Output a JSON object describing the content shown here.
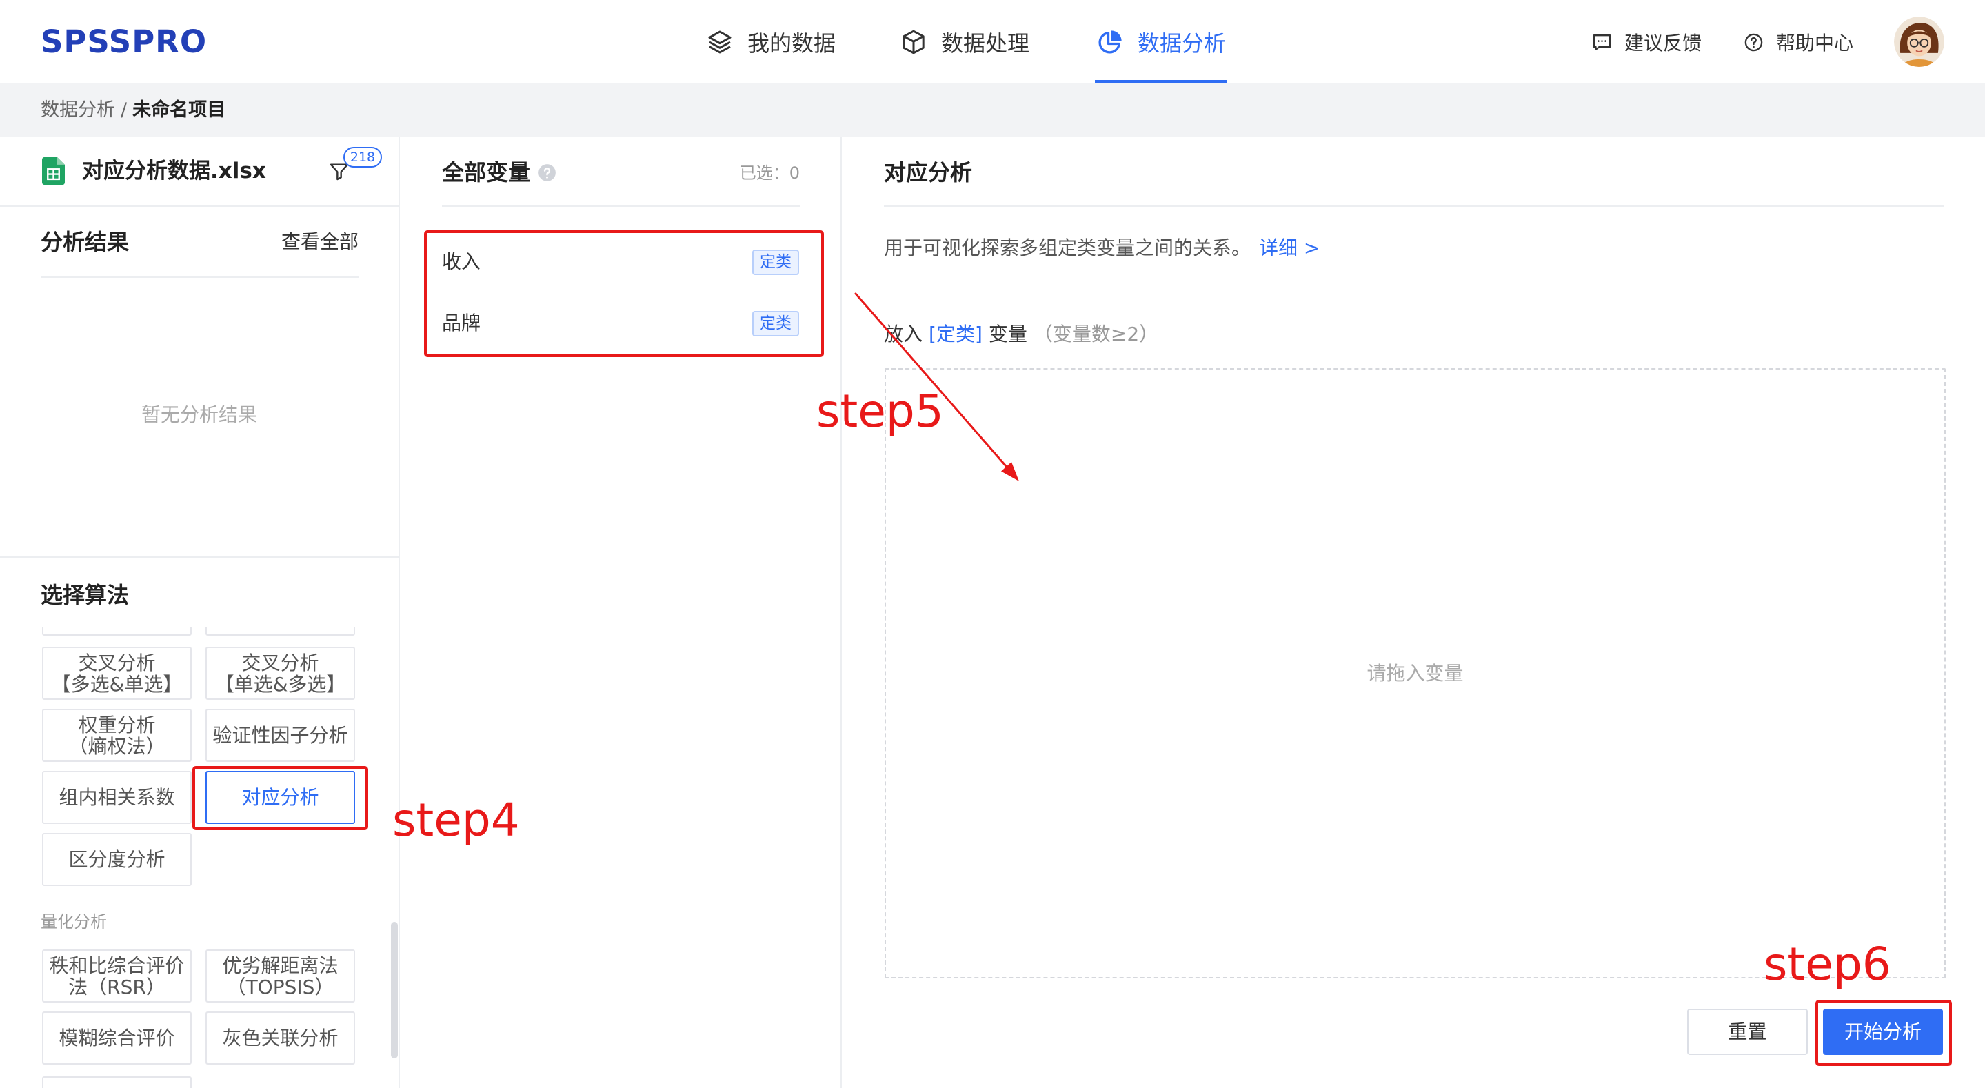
{
  "theme": {
    "primary": "#2f6df4",
    "annotation_red": "#e81919",
    "logo_blue": "#2340b7",
    "spreadsheet_green": "#1fa463",
    "breadcrumb_bg": "#f2f3f5"
  },
  "header": {
    "logo": "SPSSPRO",
    "nav": [
      {
        "label": "我的数据",
        "icon": "layers-icon",
        "active": false
      },
      {
        "label": "数据处理",
        "icon": "cube-icon",
        "active": false
      },
      {
        "label": "数据分析",
        "icon": "pie-chart-icon",
        "active": true
      }
    ],
    "actions": [
      {
        "label": "建议反馈",
        "icon": "feedback-icon"
      },
      {
        "label": "帮助中心",
        "icon": "help-icon"
      }
    ],
    "avatar_icon": "avatar-icon"
  },
  "breadcrumb": {
    "parent": "数据分析",
    "separator": "/",
    "current": "未命名项目"
  },
  "file": {
    "name": "对应分析数据.xlsx",
    "icon": "spreadsheet-icon",
    "filter_icon": "filter-icon",
    "filter_badge": "218"
  },
  "results": {
    "title": "分析结果",
    "view_all": "查看全部",
    "empty": "暂无分析结果"
  },
  "algorithms": {
    "title": "选择算法",
    "items": [
      {
        "lines": [
          "交叉分析",
          "【多选&单选】"
        ],
        "selected": false
      },
      {
        "lines": [
          "交叉分析",
          "【单选&多选】"
        ],
        "selected": false
      },
      {
        "lines": [
          "权重分析",
          "（熵权法）"
        ],
        "selected": false
      },
      {
        "lines": [
          "验证性因子分析"
        ],
        "selected": false
      },
      {
        "lines": [
          "组内相关系数"
        ],
        "selected": false
      },
      {
        "lines": [
          "对应分析"
        ],
        "selected": true
      },
      {
        "lines": [
          "区分度分析"
        ],
        "selected": false
      }
    ],
    "quant_section": {
      "label": "量化分析",
      "items": [
        {
          "lines": [
            "秩和比综合评价",
            "法（RSR）"
          ]
        },
        {
          "lines": [
            "优劣解距离法",
            "（TOPSIS）"
          ]
        },
        {
          "lines": [
            "模糊综合评价"
          ]
        },
        {
          "lines": [
            "灰色关联分析"
          ]
        }
      ]
    }
  },
  "variables": {
    "title": "全部变量",
    "help_icon": "question-icon",
    "selected_label": "已选：",
    "selected_count": "0",
    "list": [
      {
        "name": "收入",
        "type": "定类"
      },
      {
        "name": "品牌",
        "type": "定类"
      }
    ]
  },
  "analysis": {
    "title": "对应分析",
    "description": "用于可视化探索多组定类变量之间的关系。",
    "detail_link": "详细 >",
    "drop": {
      "prefix": "放入",
      "type": "[定类]",
      "suffix": "变量",
      "constraint": "（变量数≥2）",
      "placeholder": "请拖入变量"
    },
    "reset_button": "重置",
    "start_button": "开始分析"
  },
  "annotations": {
    "step4": "step4",
    "step5": "step5",
    "step6": "step6"
  }
}
